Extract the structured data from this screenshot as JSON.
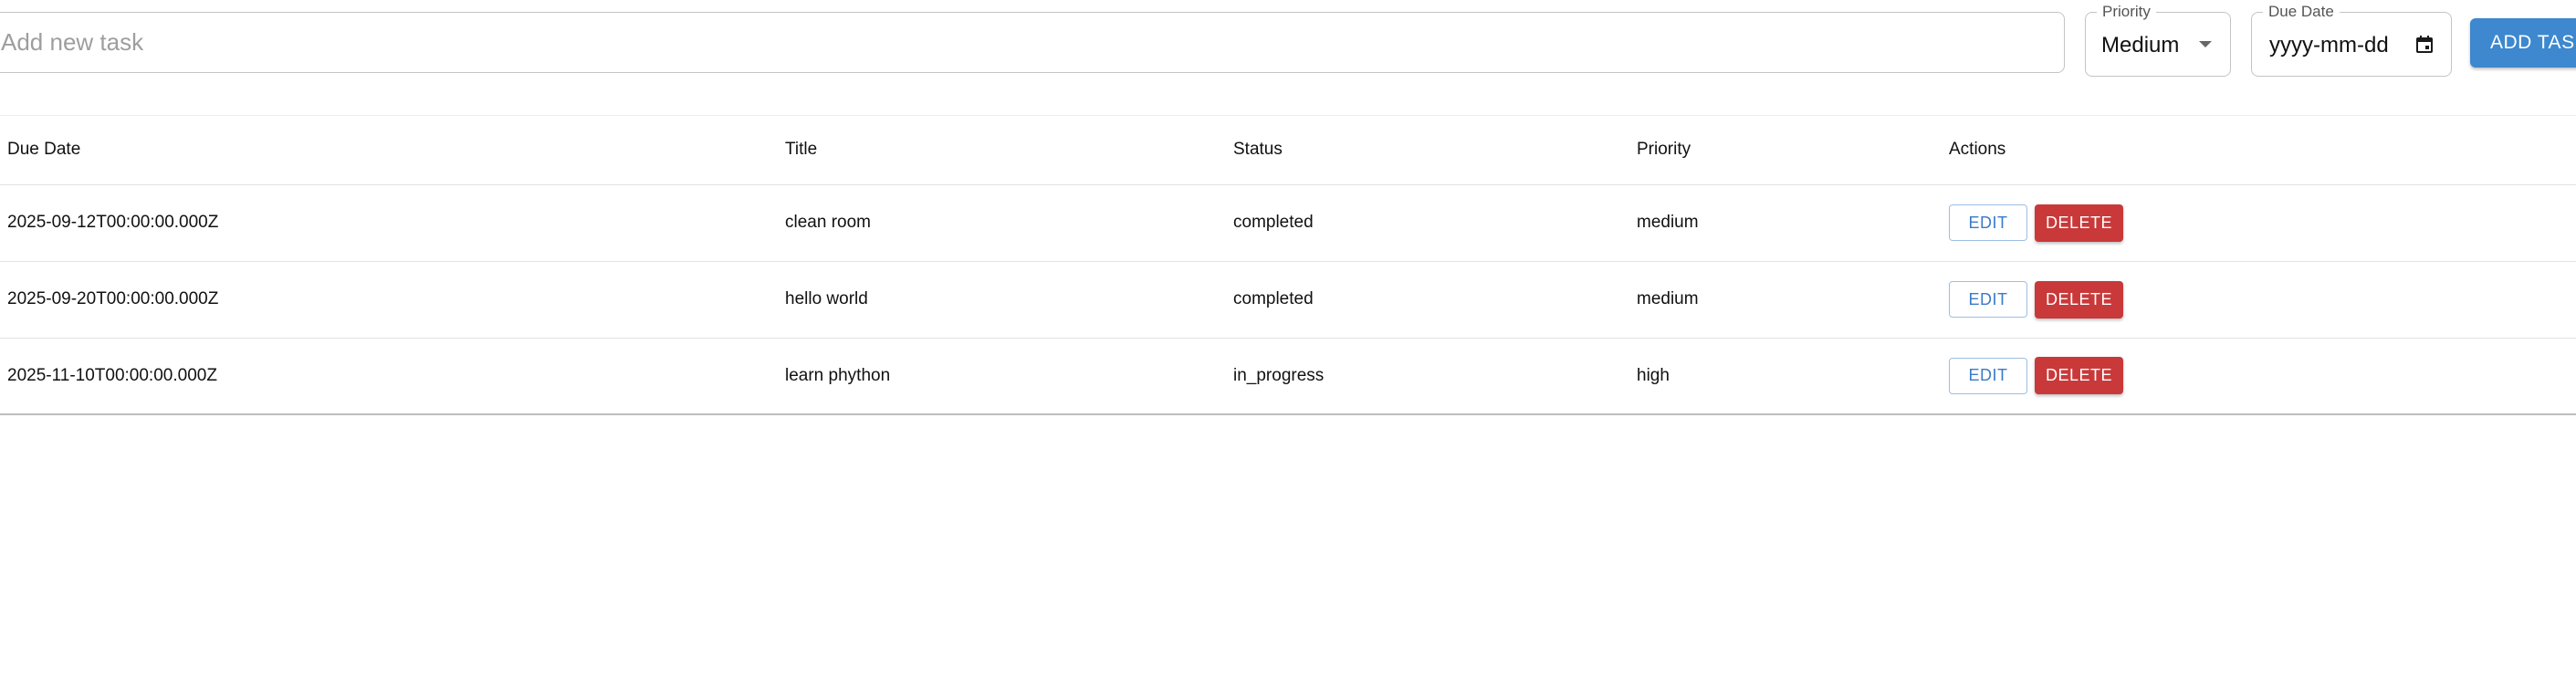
{
  "form": {
    "new_task_placeholder": "Add new task",
    "new_task_value": "",
    "priority": {
      "legend": "Priority",
      "selected": "Medium"
    },
    "due_date": {
      "legend": "Due Date",
      "placeholder": "yyyy-mm-dd"
    },
    "add_button_label": "ADD TASK"
  },
  "table": {
    "columns": [
      "Due Date",
      "Title",
      "Status",
      "Priority",
      "Actions"
    ],
    "rows": [
      {
        "due_date": "2025-09-12T00:00:00.000Z",
        "title": "clean room",
        "status": "completed",
        "priority": "medium"
      },
      {
        "due_date": "2025-09-20T00:00:00.000Z",
        "title": "hello world",
        "status": "completed",
        "priority": "medium"
      },
      {
        "due_date": "2025-11-10T00:00:00.000Z",
        "title": "learn phython",
        "status": "in_progress",
        "priority": "high"
      }
    ],
    "edit_label": "EDIT",
    "delete_label": "DELETE"
  },
  "colors": {
    "primary": "#3d88cf",
    "danger": "#c9393a",
    "border": "#c4c4c4"
  },
  "icons": {
    "priority_dropdown": "caret-down-icon",
    "due_date_picker": "calendar-icon"
  }
}
